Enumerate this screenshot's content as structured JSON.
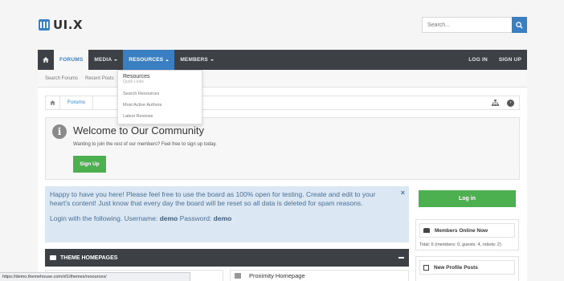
{
  "logo": {
    "text": "UI.X"
  },
  "search": {
    "placeholder": "Search..."
  },
  "nav": {
    "forums": "FORUMS",
    "media": "MEDIA",
    "resources": "RESOURCES",
    "members": "MEMBERS",
    "login": "LOG IN",
    "signup": "SIGN UP"
  },
  "subnav": {
    "items": [
      "Search Forums",
      "Recent Posts"
    ]
  },
  "dropdown": {
    "title": "Resources",
    "subtitle": "Quick Links",
    "items": [
      "Search Resources",
      "Most Active Authors",
      "Latest Reviews"
    ]
  },
  "breadcrumb": {
    "forums": "Forums"
  },
  "welcome": {
    "title": "Welcome to Our Community",
    "text": "Wanting to join the rest of our members? Feel free to sign up today.",
    "signup_label": "Sign Up"
  },
  "notice": {
    "text": "Happy to have you here! Please feel free to use the board as 100% open for testing. Create and edit to your heart's content! Just know that every day the board will be reset so all data is deleted for spam reasons.",
    "login_prefix": "Login with the following. Username:",
    "username": "demo",
    "password_label": "Password:",
    "password": "demo",
    "close": "×"
  },
  "theme_bar": {
    "title": "THEME HOMEPAGES"
  },
  "theme_card": {
    "title": "Proximity Homepage"
  },
  "sidebar": {
    "login_label": "Log in",
    "members_online_title": "Members Online Now",
    "members_online_total": "Total: 6 (members: 0, guests: 4, robots: 2)",
    "profile_posts_title": "New Profile Posts"
  },
  "statusbar": {
    "url": "https://demo.themehouse.com/xf1/themes/resources/"
  },
  "colors": {
    "accent": "#3a7fc1",
    "nav_bg": "#3d4146",
    "green": "#4caf50",
    "notice_bg": "#dbe8f4"
  }
}
